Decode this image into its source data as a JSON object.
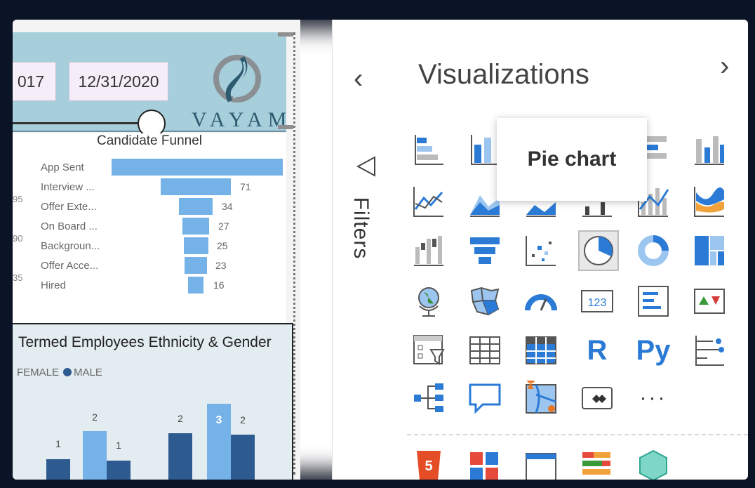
{
  "header": {
    "date_start": "017",
    "date_end": "12/31/2020",
    "logo_text": "VAYAM"
  },
  "funnel": {
    "title": "Candidate Funnel",
    "axis_labels": [
      "95",
      "90",
      "35"
    ],
    "stages": [
      {
        "label": "App Sent",
        "value": ""
      },
      {
        "label": "Interview ...",
        "value": "71"
      },
      {
        "label": "Offer Exte...",
        "value": "34"
      },
      {
        "label": "On Board ...",
        "value": "27"
      },
      {
        "label": "Backgroun...",
        "value": "25"
      },
      {
        "label": "Offer Acce...",
        "value": "23"
      },
      {
        "label": "Hired",
        "value": "16"
      }
    ]
  },
  "termed": {
    "title": "Termed Employees Ethnicity & Gender",
    "legend_female": "FEMALE",
    "legend_male": "MALE",
    "colors": {
      "male": "#2e5b8f",
      "female": "#74b2e8"
    },
    "bar_values": [
      "1",
      "2",
      "1",
      "2",
      "3",
      "2"
    ]
  },
  "filters": {
    "label": "Filters"
  },
  "visualizations": {
    "title": "Visualizations",
    "tooltip": "Pie chart",
    "text_icons": {
      "r": "R",
      "py": "Py",
      "more": "···"
    }
  }
}
